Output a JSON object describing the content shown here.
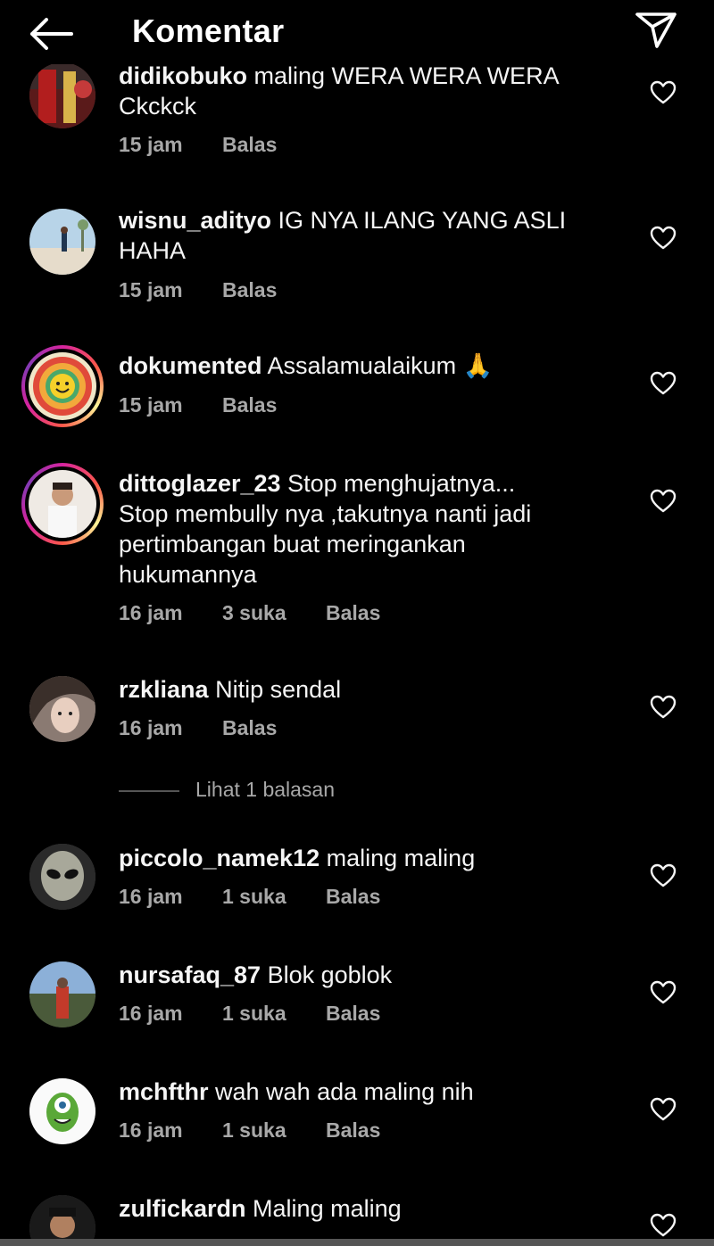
{
  "header": {
    "title": "Komentar"
  },
  "comments": [
    {
      "username": "didikobuko",
      "text": "maling WERA WERA WERA",
      "text2": "Ckckck",
      "time": "15 jam",
      "likes": "",
      "reply": "Balas"
    },
    {
      "username": "wisnu_adityo",
      "text": "IG NYA ILANG YANG ASLI HAHA",
      "time": "15 jam",
      "likes": "",
      "reply": "Balas"
    },
    {
      "username": "dokumented",
      "text": "Assalamualaikum 🙏",
      "time": "15 jam",
      "likes": "",
      "reply": "Balas"
    },
    {
      "username": "dittoglazer_23",
      "text": "Stop menghujatnya... Stop membully nya ,takutnya nanti jadi pertimbangan buat meringankan hukumannya",
      "time": "16 jam",
      "likes": "3 suka",
      "reply": "Balas"
    },
    {
      "username": "rzkliana",
      "text": "Nitip sendal",
      "time": "16 jam",
      "likes": "",
      "reply": "Balas"
    },
    {
      "username": "piccolo_namek12",
      "text": "maling maling",
      "time": "16 jam",
      "likes": "1 suka",
      "reply": "Balas"
    },
    {
      "username": "nursafaq_87",
      "text": "Blok goblok",
      "time": "16 jam",
      "likes": "1 suka",
      "reply": "Balas"
    },
    {
      "username": "mchfthr",
      "text": "wah wah ada maling nih",
      "time": "16 jam",
      "likes": "1 suka",
      "reply": "Balas"
    },
    {
      "username": "zulfickardn",
      "text": "Maling maling",
      "time": "",
      "likes": "",
      "reply": ""
    }
  ],
  "view_replies_label": "Lihat 1 balasan",
  "icons": {
    "back": "arrow-left-icon",
    "direct": "paper-plane-icon",
    "like": "heart-outline-icon"
  },
  "colors": {
    "background": "#000000",
    "text": "#f5f5f5",
    "meta": "#a8a8a8",
    "story_ring_start": "#d6249f",
    "story_ring_end": "#fdf497"
  }
}
